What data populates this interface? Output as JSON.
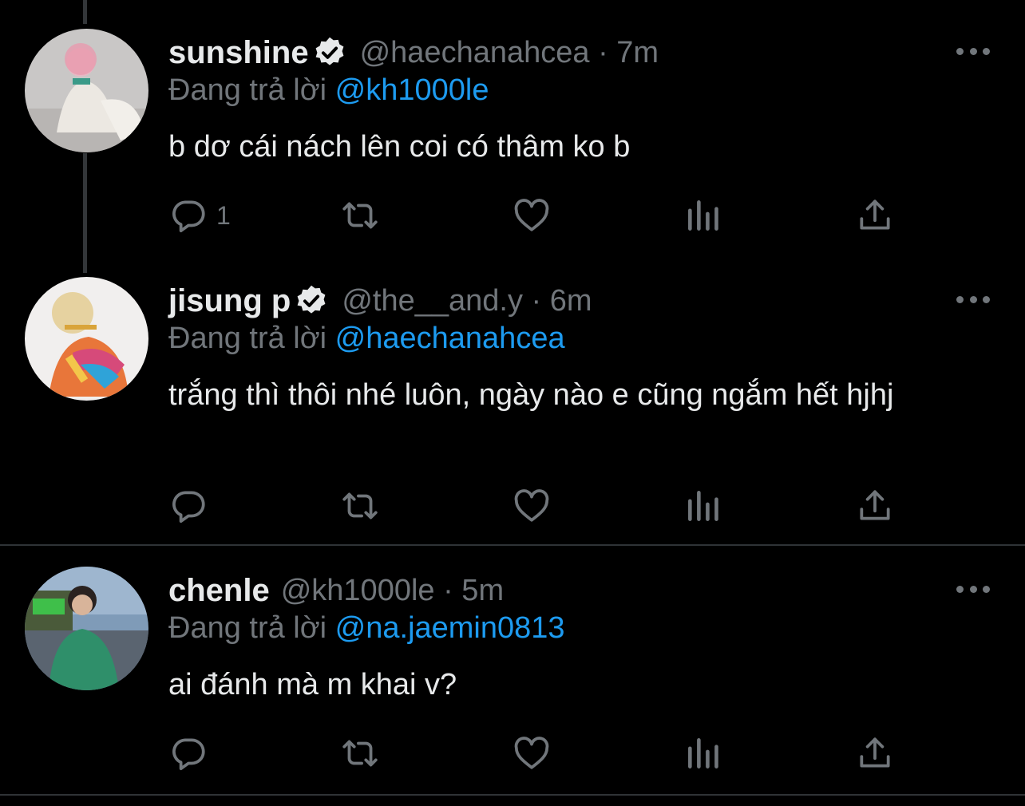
{
  "tweets": [
    {
      "name": "sunshine",
      "verified": true,
      "handle_time": "@haechanahcea · 7m",
      "replying_prefix": "Đang trả lời",
      "replying_to": "@kh1000le",
      "text": "b dơ cái nách lên coi có thâm ko b",
      "reply_count": "1"
    },
    {
      "name": "jisung p",
      "verified": true,
      "handle_time": "@the__and.y · 6m",
      "replying_prefix": "Đang trả lời",
      "replying_to": "@haechanahcea",
      "text": "trắng thì thôi nhé luôn, ngày nào e cũng ngắm hết hjhj",
      "reply_count": ""
    },
    {
      "name": "chenle",
      "verified": false,
      "handle_time": "@kh1000le · 5m",
      "replying_prefix": "Đang trả lời",
      "replying_to": "@na.jaemin0813",
      "text": "ai đánh mà m khai v?",
      "reply_count": ""
    }
  ],
  "icons": {
    "reply": "reply-icon",
    "retweet": "retweet-icon",
    "like": "heart-icon",
    "views": "views-icon",
    "share": "share-icon",
    "more": "more-icon",
    "verified": "verified-badge-icon"
  },
  "colors": {
    "background": "#000000",
    "text": "#e7e9ea",
    "secondary": "#71767b",
    "link": "#1d9bf0"
  }
}
